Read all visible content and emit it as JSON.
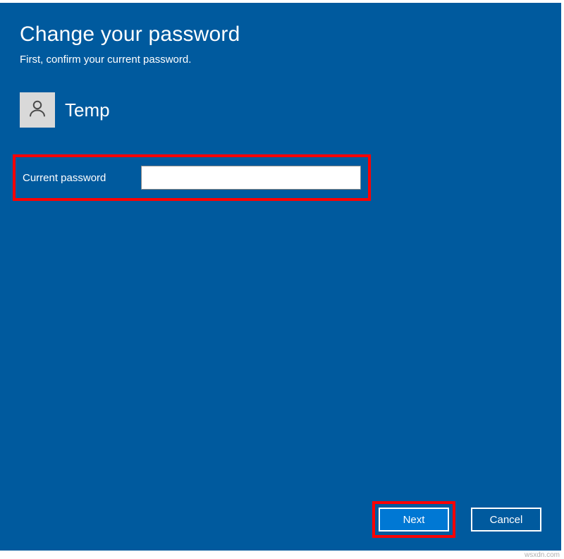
{
  "header": {
    "title": "Change your password",
    "subtitle": "First, confirm your current password."
  },
  "user": {
    "name": "Temp"
  },
  "form": {
    "current_password_label": "Current password",
    "current_password_value": ""
  },
  "buttons": {
    "next_label": "Next",
    "cancel_label": "Cancel"
  },
  "highlights": {
    "password_row": true,
    "next_button": true
  },
  "watermark": "wsxdn.com",
  "colors": {
    "dialog_bg": "#005a9e",
    "primary_button_bg": "#0078d4",
    "highlight_border": "#ff0000"
  }
}
